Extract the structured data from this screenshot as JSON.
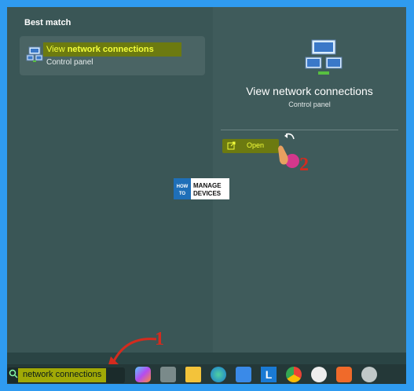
{
  "start_menu": {
    "section_label": "Best match",
    "result": {
      "title_prefix": "View ",
      "title_bold": "network connections",
      "subtitle": "Control panel"
    }
  },
  "detail": {
    "title": "View network connections",
    "subtitle": "Control panel",
    "open_label": "Open"
  },
  "watermark": {
    "left_text": "HOW TO",
    "right_top": "MANAGE",
    "right_bottom": "DEVICES"
  },
  "annotations": {
    "step1": "1",
    "step2": "2"
  },
  "taskbar": {
    "search_value": "network connections",
    "icons": [
      "copilot-icon",
      "task-view-icon",
      "file-explorer-icon",
      "edge-icon",
      "store-icon",
      "l-app-icon",
      "chrome-icon",
      "teams-icon",
      "brave-icon",
      "settings-icon"
    ]
  },
  "colors": {
    "highlight": "#6c7a10",
    "highlight_text": "#f4ff3a",
    "annotation_red": "#d42b1e",
    "frame_border": "#2f9bf0"
  }
}
